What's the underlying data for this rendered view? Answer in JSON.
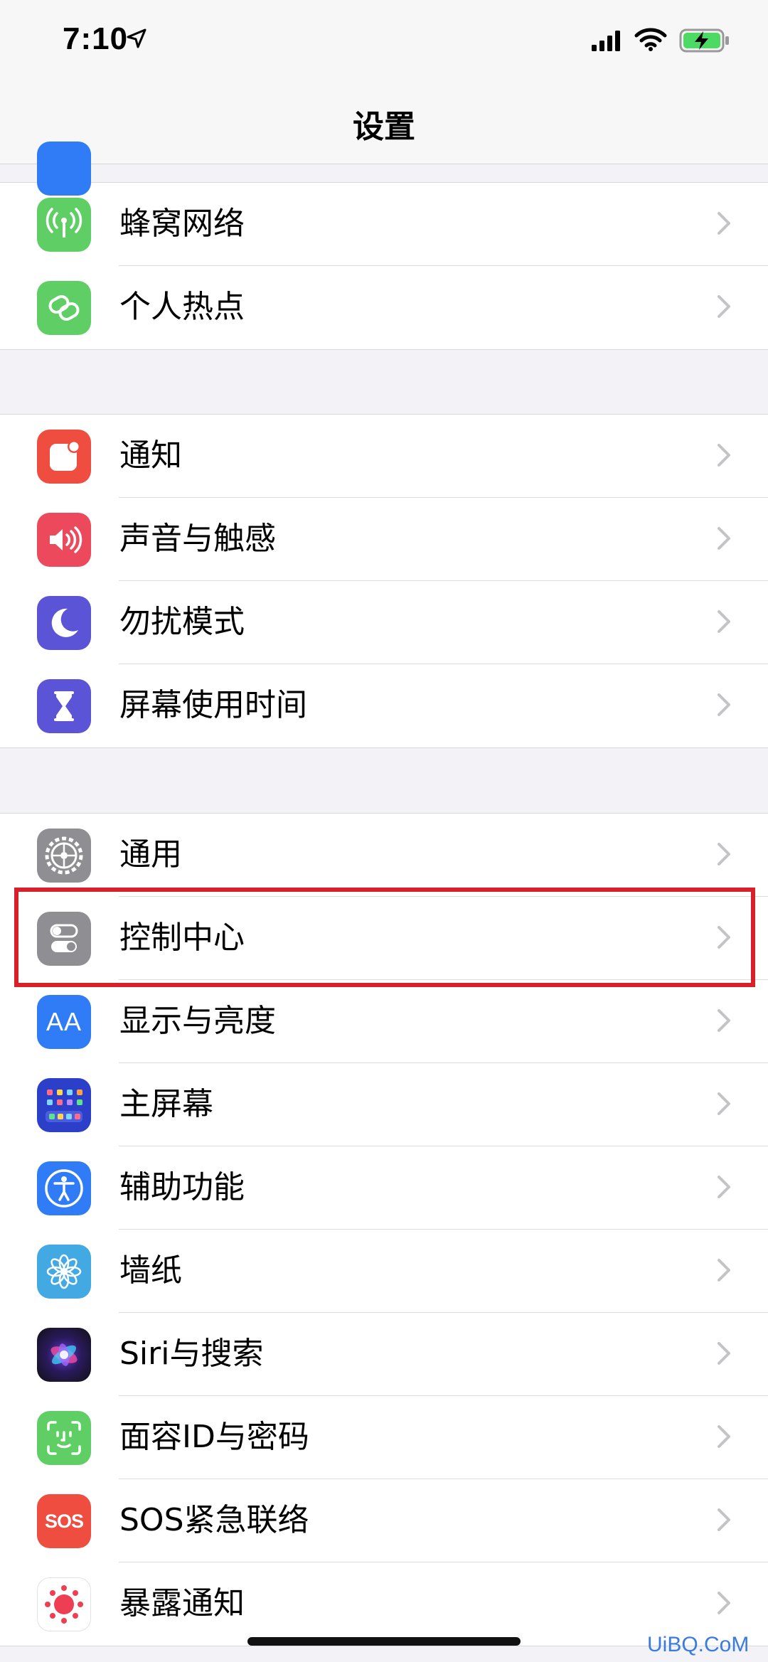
{
  "status_bar": {
    "time": "7:10"
  },
  "nav": {
    "title": "设置"
  },
  "groups": [
    {
      "items": [
        {
          "label": "蜂窝网络",
          "icon": "antenna-icon",
          "color": "#5fcf65"
        },
        {
          "label": "个人热点",
          "icon": "hotspot-link-icon",
          "color": "#5fcf65"
        }
      ]
    },
    {
      "items": [
        {
          "label": "通知",
          "icon": "notification-icon",
          "color": "#ee4d3f"
        },
        {
          "label": "声音与触感",
          "icon": "speaker-icon",
          "color": "#ec4a5c"
        },
        {
          "label": "勿扰模式",
          "icon": "moon-icon",
          "color": "#5b54d6"
        },
        {
          "label": "屏幕使用时间",
          "icon": "hourglass-icon",
          "color": "#5b54d6"
        }
      ]
    },
    {
      "items": [
        {
          "label": "通用",
          "icon": "gear-icon",
          "color": "#8e8e93"
        },
        {
          "label": "控制中心",
          "icon": "toggles-icon",
          "color": "#8e8e93"
        },
        {
          "label": "显示与亮度",
          "icon": "text-size-icon",
          "color": "#2f7cf6"
        },
        {
          "label": "主屏幕",
          "icon": "home-grid-icon",
          "color": "#2c3fc8"
        },
        {
          "label": "辅助功能",
          "icon": "accessibility-icon",
          "color": "#2f7cf6"
        },
        {
          "label": "墙纸",
          "icon": "flower-icon",
          "color": "#42a9e3"
        },
        {
          "label": "Siri与搜索",
          "icon": "siri-icon",
          "color": "#1a1a2e"
        },
        {
          "label": "面容ID与密码",
          "icon": "face-id-icon",
          "color": "#5fcf65"
        },
        {
          "label": "SOS紧急联络",
          "icon": "sos-icon",
          "color": "#ee4d3f"
        },
        {
          "label": "暴露通知",
          "icon": "exposure-icon",
          "color": "#ffffff"
        }
      ]
    }
  ],
  "icon_text": {
    "display": "AA",
    "sos": "SOS"
  },
  "watermark": "UiBQ.CoM",
  "highlight_color": "#d9202a"
}
